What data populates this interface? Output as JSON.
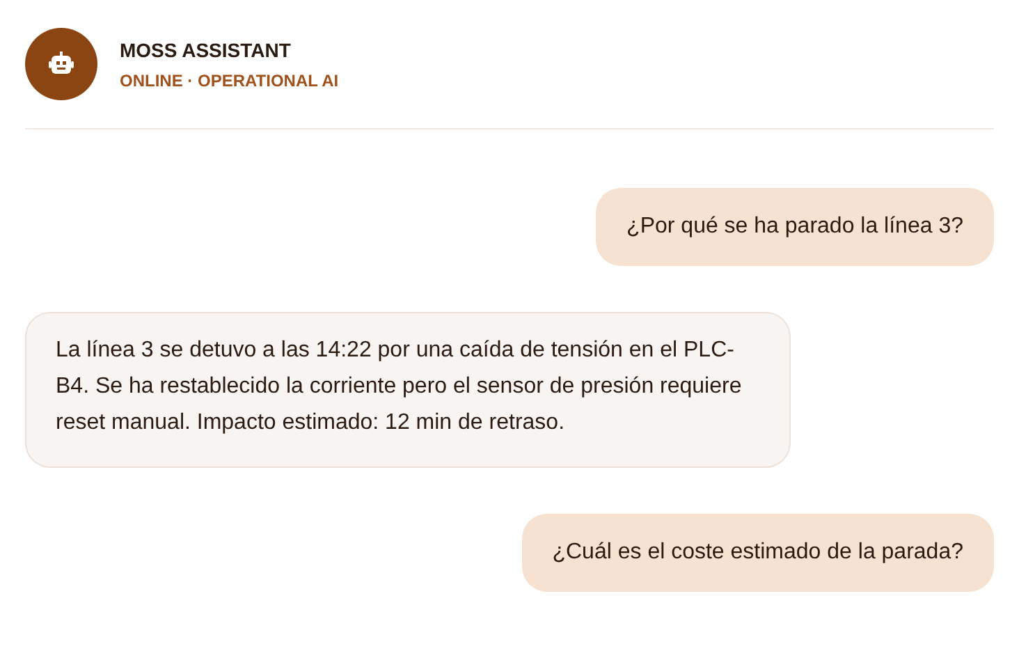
{
  "header": {
    "title": "MOSS ASSISTANT",
    "status": "ONLINE · OPERATIONAL AI"
  },
  "messages": [
    {
      "kind": "user",
      "text": "¿Por qué se ha parado la línea 3?"
    },
    {
      "kind": "assistant",
      "text": "La línea 3 se detuvo a las 14:22 por una caída de tensión en el PLC-B4. Se ha restablecido la corriente pero el sensor de presión requiere reset manual. Impacto estimado: 12 min de retraso."
    },
    {
      "kind": "user",
      "text": "¿Cuál es el coste estimado de la parada?"
    }
  ]
}
